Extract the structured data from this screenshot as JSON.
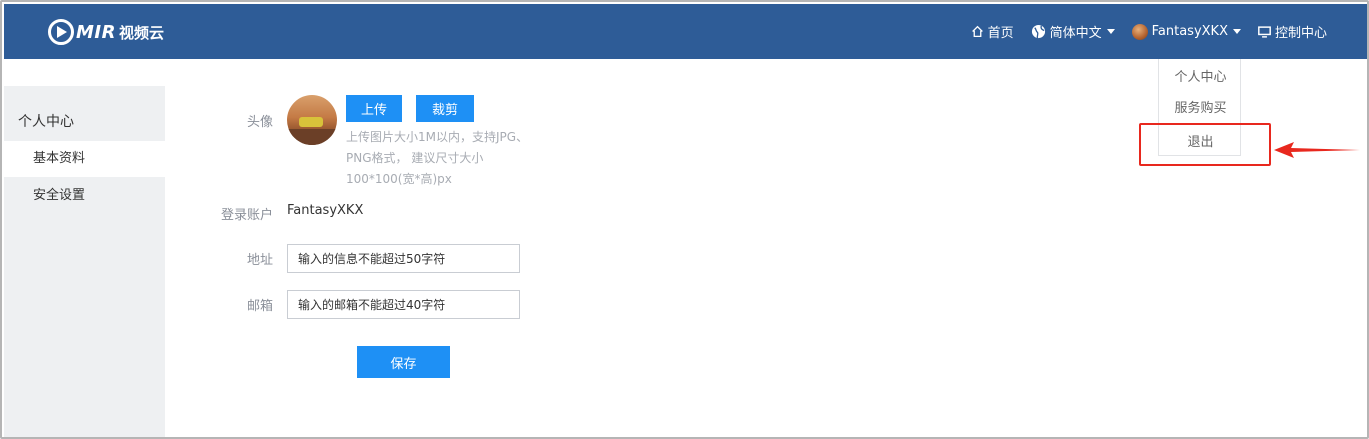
{
  "header": {
    "logo_text": "MIR",
    "logo_sub": "视频云",
    "home_label": "首页",
    "language_label": "简体中文",
    "username": "FantasyXKX",
    "console_label": "控制中心"
  },
  "user_menu": {
    "items": [
      {
        "label": "个人中心"
      },
      {
        "label": "服务购买"
      },
      {
        "label": "退出"
      }
    ]
  },
  "sidebar": {
    "title": "个人中心",
    "items": [
      {
        "label": "基本资料",
        "active": true
      },
      {
        "label": "安全设置",
        "active": false
      }
    ]
  },
  "profile": {
    "avatar_label": "头像",
    "upload_label": "上传",
    "crop_label": "裁剪",
    "upload_hint": "上传图片大小1M以内，支持JPG、PNG格式， 建议尺寸大小100*100(宽*高)px",
    "account_label": "登录账户",
    "account_value": "FantasyXKX",
    "address_label": "地址",
    "address_placeholder": "输入的信息不能超过50字符",
    "email_label": "邮箱",
    "email_placeholder": "输入的邮箱不能超过40字符",
    "save_label": "保存"
  },
  "colors": {
    "navbar": "#2e5c97",
    "primary_button": "#1e90f5",
    "annotation": "#e8281e"
  }
}
